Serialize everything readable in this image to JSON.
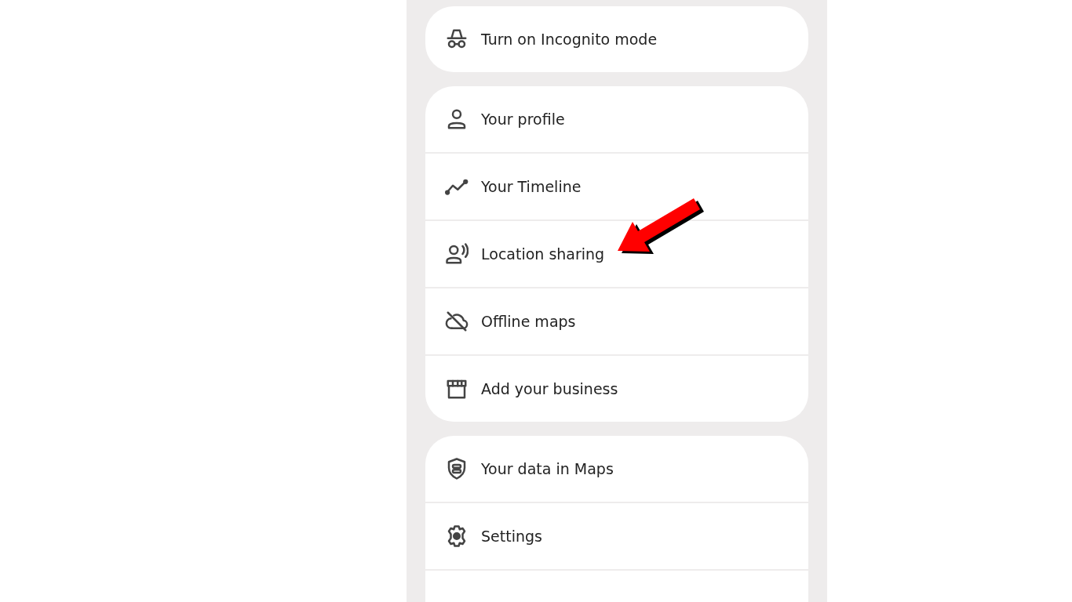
{
  "menu_groups": [
    {
      "items": [
        {
          "label": "Turn on Incognito mode"
        }
      ]
    },
    {
      "items": [
        {
          "label": "Your profile"
        },
        {
          "label": "Your Timeline"
        },
        {
          "label": "Location sharing"
        },
        {
          "label": "Offline maps"
        },
        {
          "label": "Add your business"
        }
      ]
    },
    {
      "items": [
        {
          "label": "Your data in Maps"
        },
        {
          "label": "Settings"
        }
      ],
      "partial_item": true
    }
  ]
}
